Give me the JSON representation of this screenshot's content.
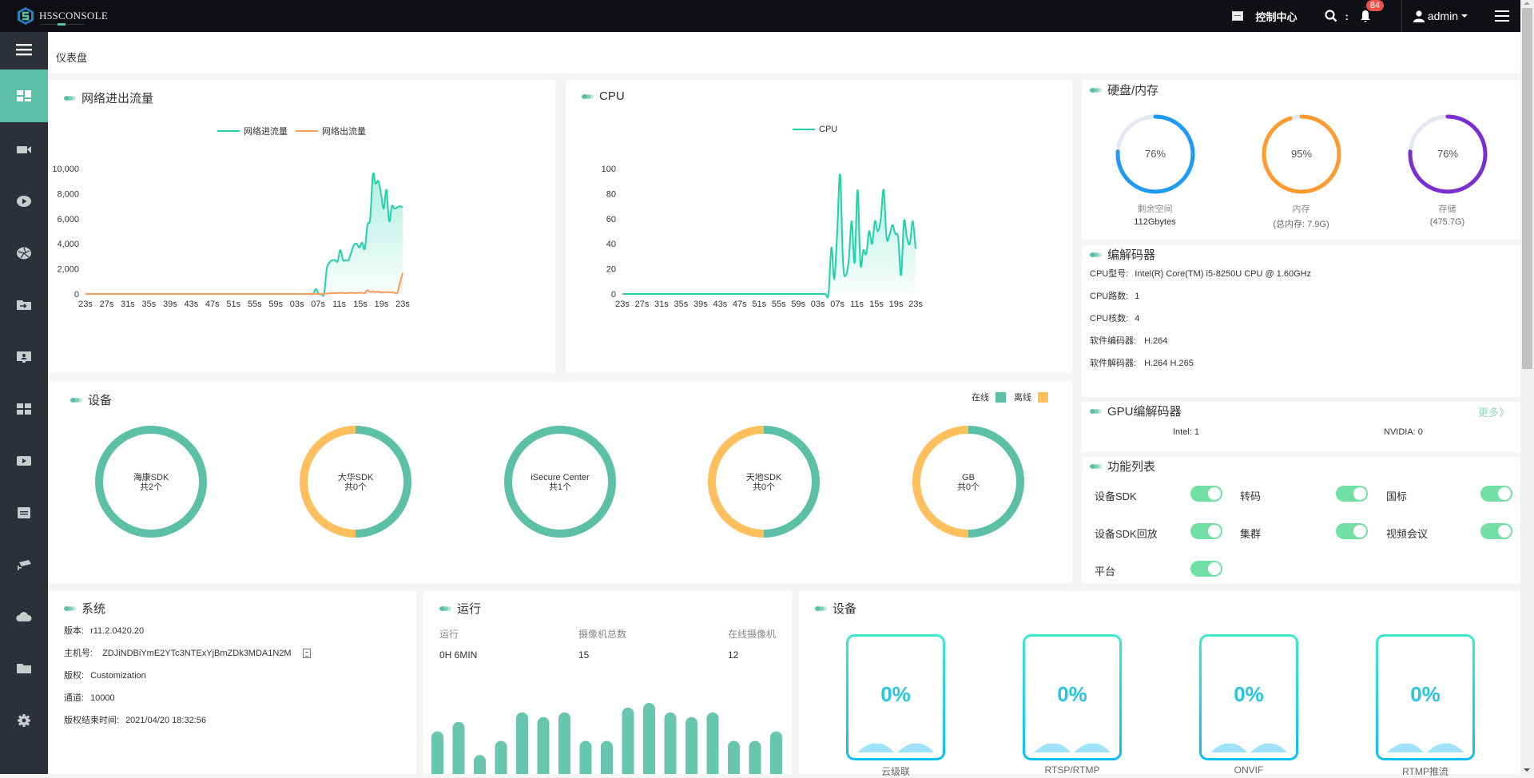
{
  "app": {
    "title": "H5SCONSOLE"
  },
  "topbar": {
    "control_center": "控制中心",
    "search_icon": "search-icon",
    "notification_count": "84",
    "user": "admin"
  },
  "sidebar": {
    "items": [
      {
        "icon": "dashboard-icon",
        "active": true
      },
      {
        "icon": "camera-icon"
      },
      {
        "icon": "play-icon"
      },
      {
        "icon": "aperture-icon"
      },
      {
        "icon": "folder-import-icon"
      },
      {
        "icon": "monitor-user-icon"
      },
      {
        "icon": "grid-icon"
      },
      {
        "icon": "video-play-icon"
      },
      {
        "icon": "list-icon"
      },
      {
        "icon": "cctv-icon"
      },
      {
        "icon": "cloud-icon"
      },
      {
        "icon": "folder-icon"
      },
      {
        "icon": "settings-icon"
      }
    ]
  },
  "breadcrumb": "仪表盘",
  "network": {
    "title": "网络进出流量",
    "chart_data": {
      "type": "area",
      "title": "网络进出流量",
      "legend": [
        "网络进流量",
        "网络出流量"
      ],
      "x": [
        "23s",
        "27s",
        "31s",
        "35s",
        "39s",
        "43s",
        "47s",
        "51s",
        "55s",
        "59s",
        "03s",
        "07s",
        "11s",
        "15s",
        "19s",
        "23s"
      ],
      "ylim": [
        0,
        10000
      ],
      "yticks": [
        "0",
        "2,000",
        "4,000",
        "6,000",
        "8,000",
        "10,000"
      ],
      "series": [
        {
          "name": "网络进流量",
          "color": "#1fd2a8",
          "values": [
            0,
            0,
            0,
            0,
            0,
            0,
            0,
            0,
            0,
            0,
            0,
            0,
            0,
            0,
            0,
            0,
            0,
            0,
            0,
            0,
            0,
            0,
            0,
            0,
            0,
            0,
            0,
            0,
            0,
            0,
            0,
            0,
            0,
            0,
            0,
            0,
            0,
            0,
            0,
            0,
            0,
            0,
            0,
            0,
            0,
            0,
            0,
            0,
            0,
            0,
            0,
            0,
            0,
            0,
            0,
            0,
            0,
            0,
            0,
            0,
            0,
            0,
            0,
            0,
            0,
            0,
            0,
            0,
            0,
            0,
            0,
            0,
            0,
            0,
            0,
            0,
            0,
            0,
            0,
            0,
            0,
            0,
            0,
            0,
            0,
            400,
            0,
            0,
            0,
            2000,
            2500,
            2700,
            2700,
            2600,
            3500,
            2700,
            2700,
            2700,
            3300,
            3900,
            4000,
            3700,
            4100,
            3600,
            5500,
            6000,
            9500,
            8800,
            9000,
            8000,
            6800,
            8300,
            5800,
            7000,
            6800,
            6900,
            7000,
            6900
          ]
        },
        {
          "name": "网络出流量",
          "color": "#ff9a5c",
          "values": [
            0,
            0,
            0,
            0,
            0,
            0,
            0,
            0,
            0,
            0,
            0,
            0,
            0,
            0,
            0,
            0,
            0,
            0,
            0,
            0,
            0,
            0,
            0,
            0,
            0,
            0,
            0,
            0,
            0,
            0,
            0,
            0,
            0,
            0,
            0,
            0,
            0,
            0,
            0,
            0,
            0,
            0,
            0,
            0,
            0,
            0,
            0,
            0,
            0,
            0,
            0,
            0,
            0,
            0,
            0,
            0,
            0,
            0,
            0,
            0,
            0,
            0,
            0,
            0,
            0,
            0,
            0,
            0,
            0,
            0,
            0,
            0,
            0,
            0,
            0,
            0,
            0,
            0,
            0,
            0,
            0,
            0,
            0,
            0,
            0,
            0,
            0,
            0,
            0,
            30,
            50,
            60,
            80,
            60,
            100,
            80,
            60,
            80,
            100,
            80,
            80,
            100,
            90,
            60,
            300,
            150,
            200,
            150,
            180,
            120,
            130,
            150,
            140,
            120,
            100,
            80,
            900,
            1700
          ]
        }
      ]
    }
  },
  "cpu": {
    "title": "CPU",
    "chart_data": {
      "type": "area",
      "title": "CPU",
      "legend": [
        "CPU"
      ],
      "x": [
        "23s",
        "27s",
        "31s",
        "35s",
        "39s",
        "43s",
        "47s",
        "51s",
        "55s",
        "59s",
        "03s",
        "07s",
        "11s",
        "15s",
        "19s",
        "23s"
      ],
      "ylim": [
        0,
        100
      ],
      "yticks": [
        "0",
        "20",
        "40",
        "60",
        "80",
        "100"
      ],
      "series": [
        {
          "name": "CPU",
          "color": "#1fd2a8",
          "values": [
            0,
            0,
            0,
            0,
            0,
            0,
            0,
            0,
            0,
            0,
            0,
            0,
            0,
            0,
            0,
            0,
            0,
            0,
            0,
            0,
            0,
            0,
            0,
            0,
            0,
            0,
            0,
            0,
            0,
            0,
            0,
            0,
            0,
            0,
            0,
            0,
            0,
            0,
            0,
            0,
            0,
            0,
            0,
            0,
            0,
            0,
            0,
            0,
            0,
            0,
            0,
            0,
            0,
            0,
            0,
            0,
            0,
            0,
            0,
            0,
            0,
            0,
            0,
            0,
            0,
            0,
            0,
            0,
            0,
            0,
            0,
            0,
            37,
            12,
            50,
            95,
            25,
            15,
            28,
            58,
            25,
            83,
            24,
            35,
            32,
            50,
            40,
            58,
            50,
            60,
            83,
            45,
            47,
            55,
            48,
            45,
            15,
            58,
            45,
            40,
            58,
            36
          ]
        }
      ]
    }
  },
  "storage": {
    "title": "硬盘/内存",
    "gauges": [
      {
        "percent": 76,
        "label": "76%",
        "name": "剩余空间",
        "detail": "112Gbytes",
        "color": "#1e9cf5"
      },
      {
        "percent": 95,
        "label": "95%",
        "name": "内存",
        "detail": "(总内存: 7.9G)",
        "color": "#ff9a2e"
      },
      {
        "percent": 76,
        "label": "76%",
        "name": "存储",
        "detail": "(475.7G)",
        "color": "#7b2fd0"
      }
    ]
  },
  "codec": {
    "title": "编解码器",
    "rows": [
      {
        "k": "CPU型号:",
        "v": "Intel(R) Core(TM) i5-8250U CPU @ 1.60GHz"
      },
      {
        "k": "CPU路数:",
        "v": "1"
      },
      {
        "k": "CPU核数:",
        "v": "4"
      },
      {
        "k": "软件编码器:",
        "v": "H.264"
      },
      {
        "k": "软件解码器:",
        "v": "H.264 H.265"
      }
    ]
  },
  "gpu": {
    "title": "GPU编解码器",
    "more": "更多》",
    "intel": "Intel: 1",
    "nvidia": "NVIDIA: 0"
  },
  "features": {
    "title": "功能列表",
    "items": [
      {
        "label": "设备SDK",
        "on": true
      },
      {
        "label": "转码",
        "on": true
      },
      {
        "label": "国标",
        "on": true
      },
      {
        "label": "设备SDK回放",
        "on": true
      },
      {
        "label": "集群",
        "on": true
      },
      {
        "label": "视频会议",
        "on": true
      },
      {
        "label": "平台",
        "on": true
      }
    ]
  },
  "devices": {
    "title": "设备",
    "legend_online": "在线",
    "legend_offline": "离线",
    "online_color": "#5cc0a6",
    "offline_color": "#ffbf5c",
    "chart_data": {
      "type": "pie",
      "items": [
        {
          "name": "海康SDK",
          "total": "共2个",
          "online": 2,
          "offline": 0
        },
        {
          "name": "大华SDK",
          "total": "共0个",
          "online": 0,
          "offline": 0
        },
        {
          "name": "iSecure Center",
          "total": "共1个",
          "online": 1,
          "offline": 0
        },
        {
          "name": "天地SDK",
          "total": "共0个",
          "online": 0,
          "offline": 0
        },
        {
          "name": "GB",
          "total": "共0个",
          "online": 0,
          "offline": 0
        }
      ]
    }
  },
  "system": {
    "title": "系统",
    "rows": [
      {
        "k": "版本:",
        "v": "r11.2.0420.20"
      },
      {
        "k": "主机号:",
        "v": "ZDJiNDBiYmE2YTc3NTExYjBmZDk3MDA1N2M"
      },
      {
        "k": "版权:",
        "v": "Customization"
      },
      {
        "k": "通道:",
        "v": "10000"
      },
      {
        "k": "版权结束时间:",
        "v": "2021/04/20 18:32:56"
      }
    ]
  },
  "run": {
    "title": "运行",
    "headers": [
      "运行",
      "摄像机总数",
      "在线摄像机"
    ],
    "values": [
      "0H 6MIN",
      "15",
      "12"
    ],
    "chart_data": {
      "type": "bar",
      "values": [
        9,
        11,
        4,
        7,
        13,
        12,
        13,
        7,
        7,
        14,
        15,
        13,
        12,
        13,
        7,
        7,
        9
      ]
    }
  },
  "protocols": {
    "title": "设备",
    "cards": [
      {
        "percent": "0%",
        "label": "云级联"
      },
      {
        "percent": "0%",
        "label": "RTSP/RTMP"
      },
      {
        "percent": "0%",
        "label": "ONVIF"
      },
      {
        "percent": "0%",
        "label": "RTMP推流"
      }
    ]
  }
}
